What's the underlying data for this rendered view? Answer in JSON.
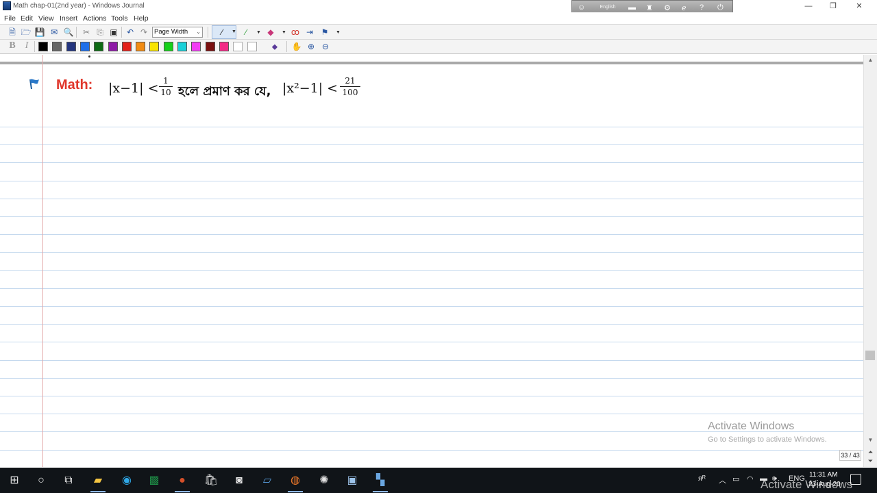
{
  "window": {
    "title": "Math chap-01(2nd year) - Windows Journal",
    "minimize": "—",
    "restore": "❐",
    "close": "✕"
  },
  "language_bar": {
    "label": "English"
  },
  "menu": [
    "File",
    "Edit",
    "View",
    "Insert",
    "Actions",
    "Tools",
    "Help"
  ],
  "toolbar": {
    "zoom_select": "Page Width",
    "bold": "B",
    "italic": "I"
  },
  "colors": [
    "#000000",
    "#666666",
    "#23357f",
    "#1f6fe8",
    "#0d6b14",
    "#8e1aa6",
    "#e3211a",
    "#f28c14",
    "#f9e400",
    "#16d11a",
    "#19d0d8",
    "#f23ef5",
    "#7a1010",
    "#f22a86",
    "#ffffff",
    "#ffffff"
  ],
  "note": {
    "math_label": "Math:",
    "expr1": "|x−1| <",
    "frac1_num": "1",
    "frac1_den": "10",
    "bengali": "হলে প্রমাণ কর যে,",
    "expr2": "|x²−1| <",
    "frac2_num": "21",
    "frac2_den": "100"
  },
  "watermark": {
    "title": "Activate Windows",
    "subtitle": "Go to Settings to activate Windows."
  },
  "page_count": "33 / 43",
  "taskbar": {
    "tray_lang": "ENG",
    "time": "11:31 AM",
    "date": "23-Aug-20",
    "overlay": "Activate Windows"
  }
}
